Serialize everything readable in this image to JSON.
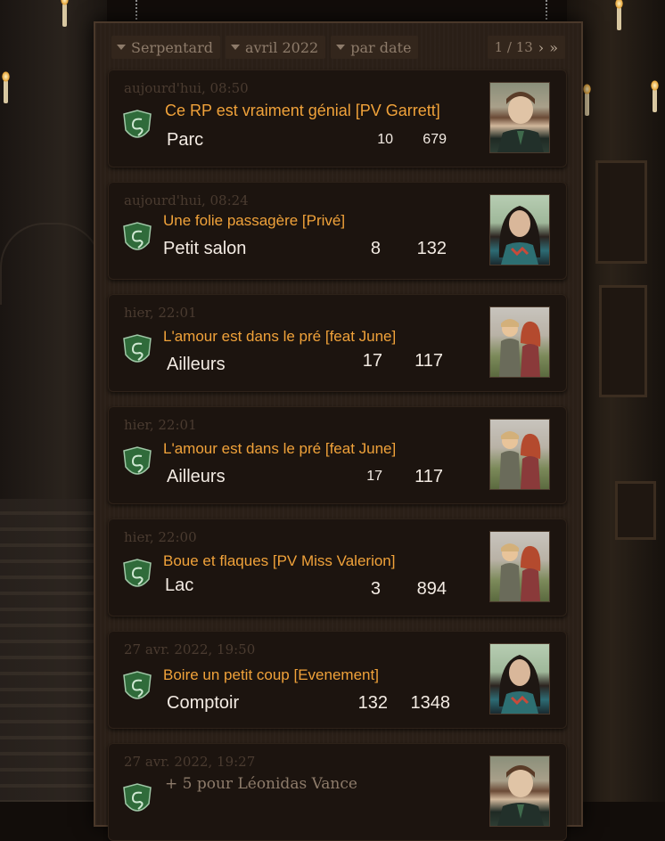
{
  "filters": [
    {
      "label": "Serpentard"
    },
    {
      "label": "avril 2022"
    },
    {
      "label": "par date"
    }
  ],
  "pager": {
    "text": "1 / 13",
    "next": "›",
    "last": "»"
  },
  "posts": [
    {
      "date": "aujourd'hui, 08:50",
      "title": "Ce RP est vraiment génial [PV Garrett]",
      "forum": "Parc",
      "replies": "10",
      "views": "679",
      "avatar": "student-boy"
    },
    {
      "date": "aujourd'hui, 08:24",
      "title": "Une folie passagère [Privé]",
      "forum": "Petit salon",
      "replies": "8",
      "views": "132",
      "avatar": "girl-dark-hair"
    },
    {
      "date": "hier, 22:01",
      "title": "L'amour est dans le pré [feat June]",
      "forum": "Ailleurs",
      "replies": "17",
      "views": "117",
      "avatar": "couple"
    },
    {
      "date": "hier, 22:01",
      "title": "L'amour est dans le pré [feat June]",
      "forum": "Ailleurs",
      "replies": "17",
      "views": "117",
      "avatar": "couple"
    },
    {
      "date": "hier, 22:00",
      "title": "Boue et flaques [PV Miss Valerion]",
      "forum": "Lac",
      "replies": "3",
      "views": "894",
      "avatar": "couple"
    },
    {
      "date": "27 avr. 2022, 19:50",
      "title": "Boire un petit coup [Evenement]",
      "forum": "Comptoir",
      "replies": "132",
      "views": "1348",
      "avatar": "girl-dark-hair"
    },
    {
      "date": "27 avr. 2022, 19:27",
      "bonus": "+ 5 pour Léonidas Vance",
      "avatar": "student-boy"
    }
  ],
  "colors": {
    "title": "#f0a23a",
    "emblem": "#2f6b3a",
    "panel": "#2a1f17"
  }
}
